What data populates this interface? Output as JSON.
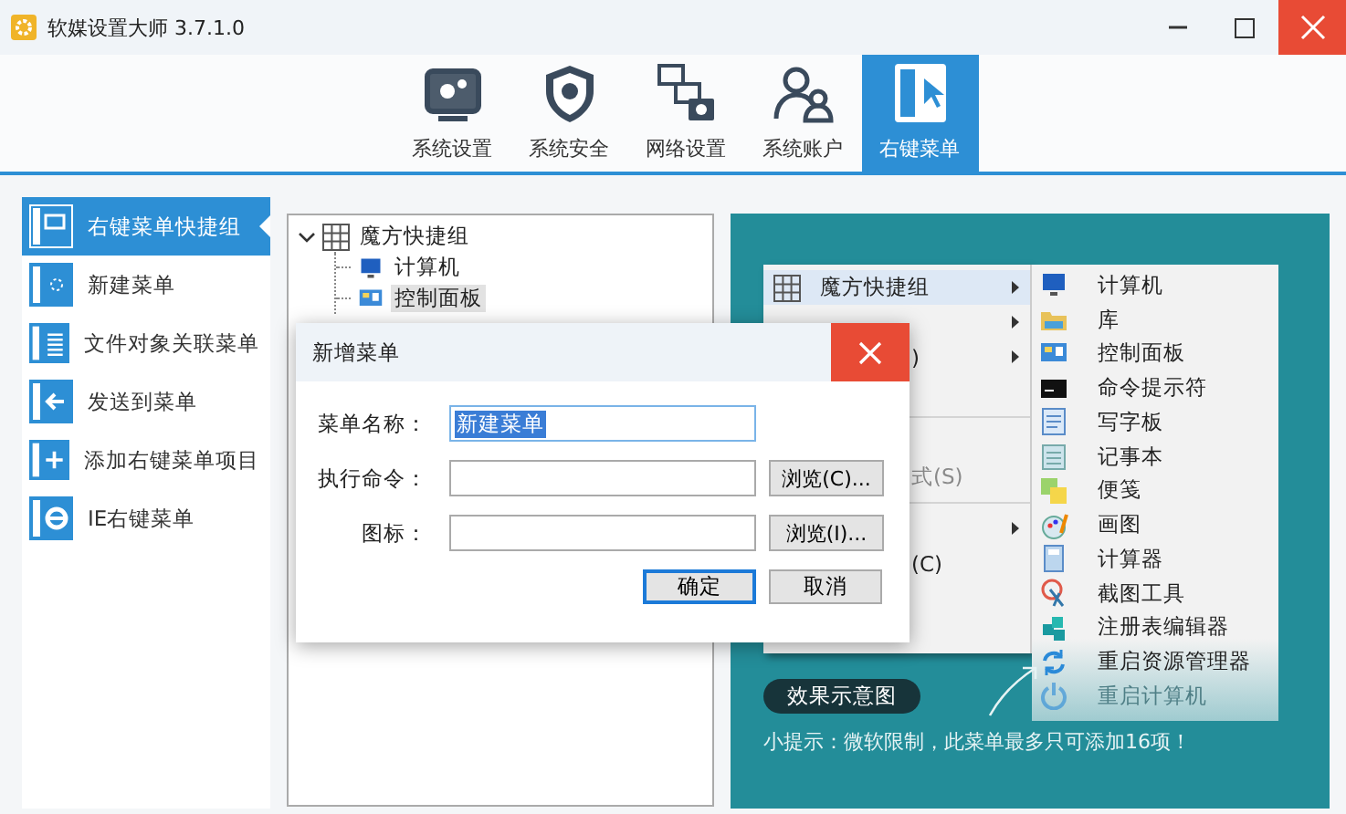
{
  "window": {
    "title": "软媒设置大师 3.7.1.0"
  },
  "toolbar": {
    "tabs": [
      {
        "label": "系统设置",
        "selected": false
      },
      {
        "label": "系统安全",
        "selected": false
      },
      {
        "label": "网络设置",
        "selected": false
      },
      {
        "label": "系统账户",
        "selected": false
      },
      {
        "label": "右键菜单",
        "selected": true
      }
    ]
  },
  "sidebar": {
    "items": [
      {
        "label": "右键菜单快捷组",
        "selected": true
      },
      {
        "label": "新建菜单",
        "selected": false
      },
      {
        "label": "文件对象关联菜单",
        "selected": false
      },
      {
        "label": "发送到菜单",
        "selected": false
      },
      {
        "label": "添加右键菜单项目",
        "selected": false
      },
      {
        "label": "IE右键菜单",
        "selected": false
      }
    ]
  },
  "tree": {
    "root": {
      "label": "魔方快捷组",
      "expanded": true,
      "children": [
        {
          "label": "计算机",
          "selected": false
        },
        {
          "label": "控制面板",
          "selected": true
        }
      ]
    }
  },
  "preview": {
    "menu": {
      "items": [
        {
          "kind": "item",
          "label": "魔方快捷组",
          "arrow": true,
          "highlighted": true
        },
        {
          "kind": "item",
          "arrow": true,
          "highlighted": false
        },
        {
          "kind": "partial",
          "label": ")",
          "arrow": true,
          "highlighted": false
        },
        {
          "kind": "item",
          "arrow": false,
          "highlighted": false
        },
        {
          "kind": "separator"
        },
        {
          "kind": "item",
          "arrow": false,
          "highlighted": false
        },
        {
          "kind": "partial",
          "label": "式(S)",
          "arrow": false,
          "highlighted": false,
          "disabled": true
        },
        {
          "kind": "separator"
        },
        {
          "kind": "item",
          "arrow": true,
          "highlighted": false
        },
        {
          "kind": "partial",
          "label": "(C)",
          "arrow": false,
          "highlighted": false,
          "disabled": false
        },
        {
          "kind": "item",
          "arrow": false,
          "highlighted": false
        },
        {
          "kind": "item",
          "arrow": false,
          "highlighted": false
        }
      ]
    },
    "submenu": {
      "items": [
        {
          "label": "计算机",
          "dimmed": false
        },
        {
          "label": "库",
          "dimmed": false
        },
        {
          "label": "控制面板",
          "dimmed": false
        },
        {
          "label": "命令提示符",
          "dimmed": false
        },
        {
          "label": "写字板",
          "dimmed": false
        },
        {
          "label": "记事本",
          "dimmed": false
        },
        {
          "label": "便笺",
          "dimmed": false
        },
        {
          "label": "画图",
          "dimmed": false
        },
        {
          "label": "计算器",
          "dimmed": false
        },
        {
          "label": "截图工具",
          "dimmed": false
        },
        {
          "label": "注册表编辑器",
          "dimmed": false
        },
        {
          "label": "重启资源管理器",
          "dimmed": false
        },
        {
          "label": "重启计算机",
          "dimmed": true
        }
      ]
    },
    "caption_button": "效果示意图",
    "tip": "小提示：微软限制，此菜单最多只可添加16项！"
  },
  "dialog": {
    "title": "新增菜单",
    "fields": [
      {
        "label": "菜单名称：",
        "value": "新建菜单",
        "focused": true
      },
      {
        "label": "执行命令：",
        "browse": "浏览(C)...",
        "focused": false
      },
      {
        "label": "图标：",
        "browse": "浏览(I)...",
        "focused": false
      }
    ],
    "buttons": [
      {
        "label": "确定",
        "default": true
      },
      {
        "label": "取消",
        "default": false
      }
    ]
  }
}
